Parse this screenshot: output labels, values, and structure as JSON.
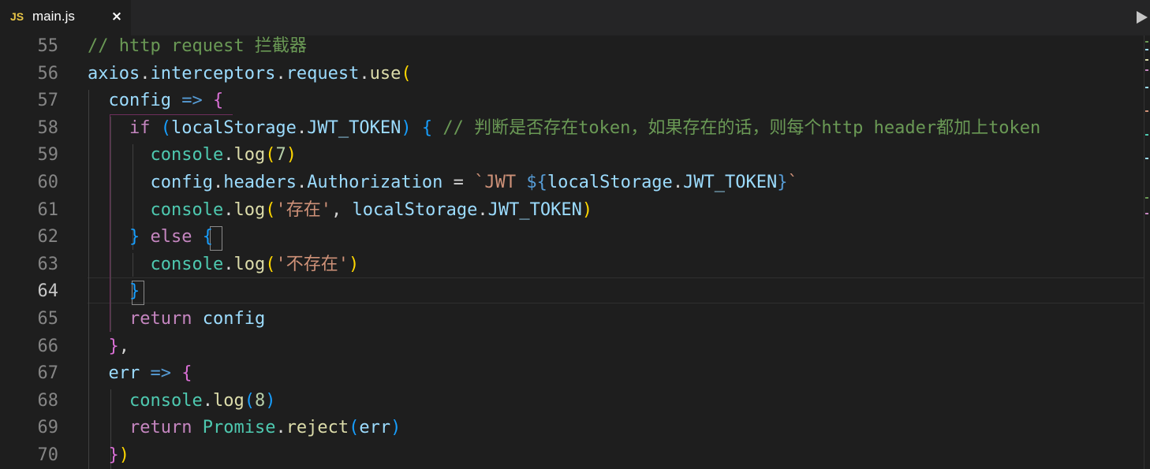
{
  "tab": {
    "icon": "JS",
    "filename": "main.js",
    "close": "×"
  },
  "icons": {
    "tab_icon": "js-file-icon",
    "close": "close-icon",
    "run": "play-icon"
  },
  "editor": {
    "active_line": "64",
    "lines": [
      {
        "num": "55",
        "tokens": [
          {
            "t": "// http request 拦截器",
            "c": "cmt"
          }
        ]
      },
      {
        "num": "56",
        "tokens": [
          {
            "t": "axios",
            "c": "var"
          },
          {
            "t": ".",
            "c": "op"
          },
          {
            "t": "interceptors",
            "c": "var"
          },
          {
            "t": ".",
            "c": "op"
          },
          {
            "t": "request",
            "c": "var"
          },
          {
            "t": ".",
            "c": "op"
          },
          {
            "t": "use",
            "c": "fn"
          },
          {
            "t": "(",
            "c": "b1"
          }
        ]
      },
      {
        "num": "57",
        "tokens": [
          {
            "t": "  ",
            "c": "op"
          },
          {
            "t": "config",
            "c": "var"
          },
          {
            "t": " ",
            "c": "op"
          },
          {
            "t": "=>",
            "c": "tpl"
          },
          {
            "t": " ",
            "c": "op"
          },
          {
            "t": "{",
            "c": "b2"
          }
        ]
      },
      {
        "num": "58",
        "tokens": [
          {
            "t": "    ",
            "c": "op"
          },
          {
            "t": "if",
            "c": "kw"
          },
          {
            "t": " ",
            "c": "op"
          },
          {
            "t": "(",
            "c": "b3"
          },
          {
            "t": "localStorage",
            "c": "var"
          },
          {
            "t": ".",
            "c": "op"
          },
          {
            "t": "JWT_TOKEN",
            "c": "var"
          },
          {
            "t": ")",
            "c": "b3"
          },
          {
            "t": " ",
            "c": "op"
          },
          {
            "t": "{",
            "c": "b3"
          },
          {
            "t": " ",
            "c": "op"
          },
          {
            "t": "// 判断是否存在token，如果存在的话，则每个http header都加上token",
            "c": "cmt"
          }
        ]
      },
      {
        "num": "59",
        "tokens": [
          {
            "t": "      ",
            "c": "op"
          },
          {
            "t": "console",
            "c": "cls"
          },
          {
            "t": ".",
            "c": "op"
          },
          {
            "t": "log",
            "c": "fn"
          },
          {
            "t": "(",
            "c": "b1"
          },
          {
            "t": "7",
            "c": "num"
          },
          {
            "t": ")",
            "c": "b1"
          }
        ]
      },
      {
        "num": "60",
        "tokens": [
          {
            "t": "      ",
            "c": "op"
          },
          {
            "t": "config",
            "c": "var"
          },
          {
            "t": ".",
            "c": "op"
          },
          {
            "t": "headers",
            "c": "var"
          },
          {
            "t": ".",
            "c": "op"
          },
          {
            "t": "Authorization",
            "c": "var"
          },
          {
            "t": " = ",
            "c": "op"
          },
          {
            "t": "`JWT ",
            "c": "str"
          },
          {
            "t": "${",
            "c": "tpl"
          },
          {
            "t": "localStorage",
            "c": "var"
          },
          {
            "t": ".",
            "c": "op"
          },
          {
            "t": "JWT_TOKEN",
            "c": "var"
          },
          {
            "t": "}",
            "c": "tpl"
          },
          {
            "t": "`",
            "c": "str"
          }
        ]
      },
      {
        "num": "61",
        "tokens": [
          {
            "t": "      ",
            "c": "op"
          },
          {
            "t": "console",
            "c": "cls"
          },
          {
            "t": ".",
            "c": "op"
          },
          {
            "t": "log",
            "c": "fn"
          },
          {
            "t": "(",
            "c": "b1"
          },
          {
            "t": "'存在'",
            "c": "str"
          },
          {
            "t": ", ",
            "c": "op"
          },
          {
            "t": "localStorage",
            "c": "var"
          },
          {
            "t": ".",
            "c": "op"
          },
          {
            "t": "JWT_TOKEN",
            "c": "var"
          },
          {
            "t": ")",
            "c": "b1"
          }
        ]
      },
      {
        "num": "62",
        "tokens": [
          {
            "t": "    ",
            "c": "op"
          },
          {
            "t": "}",
            "c": "b3"
          },
          {
            "t": " ",
            "c": "op"
          },
          {
            "t": "else",
            "c": "kw"
          },
          {
            "t": " ",
            "c": "op"
          },
          {
            "t": "{",
            "c": "b3"
          }
        ]
      },
      {
        "num": "63",
        "tokens": [
          {
            "t": "      ",
            "c": "op"
          },
          {
            "t": "console",
            "c": "cls"
          },
          {
            "t": ".",
            "c": "op"
          },
          {
            "t": "log",
            "c": "fn"
          },
          {
            "t": "(",
            "c": "b1"
          },
          {
            "t": "'不存在'",
            "c": "str"
          },
          {
            "t": ")",
            "c": "b1"
          }
        ]
      },
      {
        "num": "64",
        "tokens": [
          {
            "t": "    ",
            "c": "op"
          },
          {
            "t": "}",
            "c": "b3"
          }
        ]
      },
      {
        "num": "65",
        "tokens": [
          {
            "t": "    ",
            "c": "op"
          },
          {
            "t": "return",
            "c": "kw"
          },
          {
            "t": " ",
            "c": "op"
          },
          {
            "t": "config",
            "c": "var"
          }
        ]
      },
      {
        "num": "66",
        "tokens": [
          {
            "t": "  ",
            "c": "op"
          },
          {
            "t": "}",
            "c": "b2"
          },
          {
            "t": ",",
            "c": "op"
          }
        ]
      },
      {
        "num": "67",
        "tokens": [
          {
            "t": "  ",
            "c": "op"
          },
          {
            "t": "err",
            "c": "var"
          },
          {
            "t": " ",
            "c": "op"
          },
          {
            "t": "=>",
            "c": "tpl"
          },
          {
            "t": " ",
            "c": "op"
          },
          {
            "t": "{",
            "c": "b2"
          }
        ]
      },
      {
        "num": "68",
        "tokens": [
          {
            "t": "    ",
            "c": "op"
          },
          {
            "t": "console",
            "c": "cls"
          },
          {
            "t": ".",
            "c": "op"
          },
          {
            "t": "log",
            "c": "fn"
          },
          {
            "t": "(",
            "c": "b3"
          },
          {
            "t": "8",
            "c": "num"
          },
          {
            "t": ")",
            "c": "b3"
          }
        ]
      },
      {
        "num": "69",
        "tokens": [
          {
            "t": "    ",
            "c": "op"
          },
          {
            "t": "return",
            "c": "kw"
          },
          {
            "t": " ",
            "c": "op"
          },
          {
            "t": "Promise",
            "c": "cls"
          },
          {
            "t": ".",
            "c": "op"
          },
          {
            "t": "reject",
            "c": "fn"
          },
          {
            "t": "(",
            "c": "b3"
          },
          {
            "t": "err",
            "c": "var"
          },
          {
            "t": ")",
            "c": "b3"
          }
        ]
      },
      {
        "num": "70",
        "tokens": [
          {
            "t": "  ",
            "c": "op"
          },
          {
            "t": "}",
            "c": "b2"
          },
          {
            "t": ")",
            "c": "b1"
          }
        ]
      }
    ]
  },
  "colors": {
    "background": "#1e1e1e",
    "comment": "#6a9955",
    "variable": "#9cdcfe",
    "function": "#dcdcaa",
    "keyword": "#c586c0",
    "class": "#4ec9b0",
    "string": "#ce9178",
    "number": "#b5cea8",
    "js_icon": "#e8c547"
  }
}
